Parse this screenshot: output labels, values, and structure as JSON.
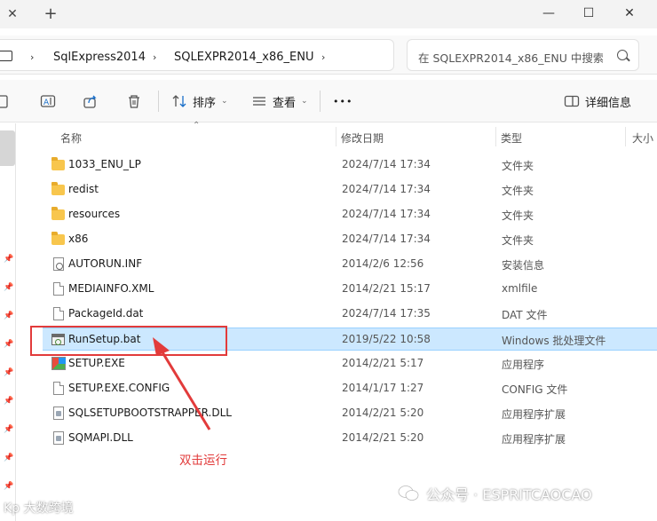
{
  "titlebar": {
    "tab_close_glyph": "✕",
    "new_tab_glyph": "+",
    "minimize_glyph": "—",
    "maximize_glyph": "☐",
    "close_glyph": "✕"
  },
  "address": {
    "breadcrumb": [
      "SqlExpress2014",
      "SQLEXPR2014_x86_ENU"
    ],
    "separator": "›"
  },
  "search": {
    "placeholder": "在 SQLEXPR2014_x86_ENU 中搜索"
  },
  "toolbar": {
    "sort_label": "排序",
    "view_label": "查看",
    "more_label": "•••",
    "details_label": "详细信息"
  },
  "columns": {
    "name": "名称",
    "modified": "修改日期",
    "type": "类型",
    "size": "大小"
  },
  "files": [
    {
      "name": "1033_ENU_LP",
      "modified": "2024/7/14 17:34",
      "type": "文件夹",
      "icon": "folder-icon"
    },
    {
      "name": "redist",
      "modified": "2024/7/14 17:34",
      "type": "文件夹",
      "icon": "folder-icon"
    },
    {
      "name": "resources",
      "modified": "2024/7/14 17:34",
      "type": "文件夹",
      "icon": "folder-icon"
    },
    {
      "name": "x86",
      "modified": "2024/7/14 17:34",
      "type": "文件夹",
      "icon": "folder-icon"
    },
    {
      "name": "AUTORUN.INF",
      "modified": "2014/2/6 12:56",
      "type": "安装信息",
      "icon": "config-file-icon"
    },
    {
      "name": "MEDIAINFO.XML",
      "modified": "2014/2/21 15:17",
      "type": "xmlfile",
      "icon": "document-icon"
    },
    {
      "name": "PackageId.dat",
      "modified": "2024/7/14 17:35",
      "type": "DAT 文件",
      "icon": "document-icon"
    },
    {
      "name": "RunSetup.bat",
      "modified": "2019/5/22 10:58",
      "type": "Windows 批处理文件",
      "icon": "batch-file-icon"
    },
    {
      "name": "SETUP.EXE",
      "modified": "2014/2/21 5:17",
      "type": "应用程序",
      "icon": "setup-exe-icon"
    },
    {
      "name": "SETUP.EXE.CONFIG",
      "modified": "2014/1/17 1:27",
      "type": "CONFIG 文件",
      "icon": "document-icon"
    },
    {
      "name": "SQLSETUPBOOTSTRAPPER.DLL",
      "modified": "2014/2/21 5:20",
      "type": "应用程序扩展",
      "icon": "dll-icon"
    },
    {
      "name": "SQMAPI.DLL",
      "modified": "2014/2/21 5:20",
      "type": "应用程序扩展",
      "icon": "dll-icon"
    }
  ],
  "annotation": {
    "text": "双击运行",
    "color": "#e23b3b"
  },
  "watermark": {
    "text": "公众号 · ESPRITCAOCAO",
    "corner_text": "Kp 大数跨境"
  },
  "colors": {
    "selection_bg": "#cce8ff",
    "annotation_red": "#e23b3b",
    "folder_yellow": "#f8c64d"
  }
}
